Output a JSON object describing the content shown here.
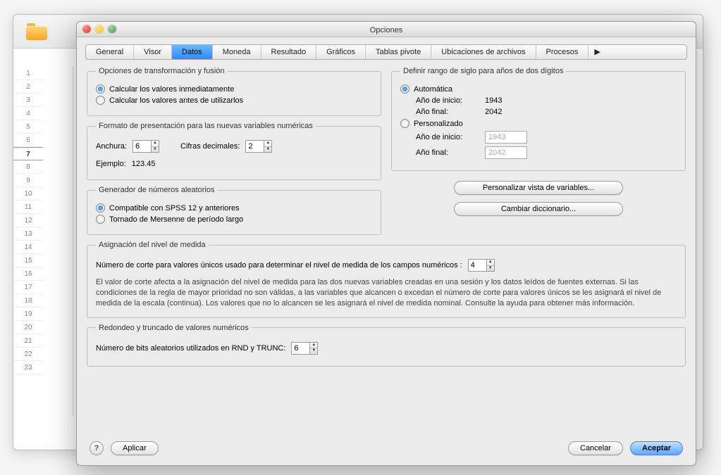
{
  "bg": {
    "rows": [
      "1",
      "2",
      "3",
      "4",
      "5",
      "6",
      "7",
      "8",
      "9",
      "10",
      "11",
      "12",
      "13",
      "14",
      "15",
      "16",
      "17",
      "18",
      "19",
      "20",
      "21",
      "22",
      "23"
    ],
    "selected": "7"
  },
  "dialog": {
    "title": "Opciones",
    "tabs": [
      "General",
      "Visor",
      "Datos",
      "Moneda",
      "Resultado",
      "Gráficos",
      "Tablas pivote",
      "Ubicaciones de archivos",
      "Procesos"
    ],
    "active_tab": "Datos",
    "more_glyph": "▶"
  },
  "transform": {
    "legend": "Opciones de transformación y fusión",
    "opt1": "Calcular los valores inmediatamente",
    "opt2": "Calcular los valores antes de utilizarlos",
    "selected": "opt1"
  },
  "format": {
    "legend": "Formato de presentación para las nuevas variables numéricas",
    "width_label": "Anchura:",
    "width": "6",
    "decimals_label": "Cifras decimales:",
    "decimals": "2",
    "example_label": "Ejemplo:",
    "example": "123.45"
  },
  "rng": {
    "legend": "Generador de números aleatorios",
    "opt1": "Compatible con SPSS 12 y anteriores",
    "opt2": "Tornado de Mersenne de período largo",
    "selected": "opt1"
  },
  "century": {
    "legend": "Definir rango de siglo para años de dos dígitos",
    "auto": "Automática",
    "custom": "Personalizado",
    "selected": "auto",
    "start_label": "Año de inicio:",
    "end_label": "Año final:",
    "auto_start": "1943",
    "auto_end": "2042",
    "custom_start": "1943",
    "custom_end": "2042"
  },
  "buttons": {
    "customize_vars": "Personalizar vista de variables...",
    "change_dict": "Cambiar diccionario..."
  },
  "measure": {
    "legend": "Asignación del nivel de medida",
    "cutoff_label": "Número de corte para valores únicos usado para determinar el nivel de medida de los campos numéricos :",
    "cutoff": "4",
    "help_text": "El valor de corte afecta a la asignación del nivel de medida para las dos nuevas variables creadas en una sesión y los datos leídos de fuentes externas. Si las condiciones de la regla de mayor prioridad no son válidas, a las variables que alcancen o excedan el número de corte para valores únicos se les asignará el nivel de medida de la escala (continua). Los valores que no lo alcancen se les asignará el nivel de medida nominal. Consulte la ayuda para obtener más información."
  },
  "round": {
    "legend": "Redondeo y truncado de valores numéricos",
    "bits_label": "Número de bits aleatorios utilizados en RND y TRUNC:",
    "bits": "6"
  },
  "footer": {
    "help": "?",
    "apply": "Aplicar",
    "cancel": "Cancelar",
    "ok": "Aceptar"
  }
}
